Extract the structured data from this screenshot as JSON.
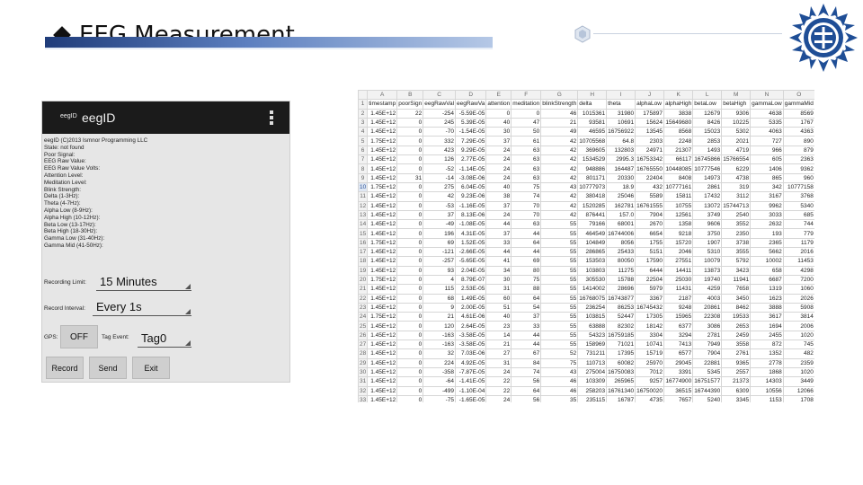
{
  "slide": {
    "title": "EEG Measurement",
    "colors": {
      "title_bar": "#1f3c7a",
      "logo": "#1f4e96"
    }
  },
  "phone": {
    "appbar": {
      "small_label": "eegID",
      "name": "eegID",
      "menu_icon": "overflow-menu-icon"
    },
    "fields": [
      "eegID (C)2013 Ismnor Programming LLC",
      "State: not found",
      "Poor Signal:",
      "EEG Raw Value:",
      "EEG Raw Value Volts:",
      "Attention Level:",
      "Meditation Level:",
      "Blink Strength:",
      "Delta (1-3Hz):",
      "Theta (4-7Hz):",
      "Alpha Low (8-9Hz):",
      "Alpha High (10-12Hz):",
      "Beta Low (13-17Hz):",
      "Beta High (18-30Hz):",
      "Gamma Low (31-40Hz):",
      "Gamma Mid (41-50Hz):"
    ],
    "recording_limit": {
      "label": "Recording Limit:",
      "value": "15 Minutes"
    },
    "record_interval": {
      "label": "Record Interval:",
      "value": "Every 1s"
    },
    "gps": {
      "label": "GPS:",
      "value": "OFF"
    },
    "tag_event": {
      "label": "Tag Event:",
      "value": "Tag0"
    },
    "buttons": {
      "record": "Record",
      "send": "Send",
      "exit": "Exit"
    }
  },
  "sheet": {
    "columns": [
      "",
      "A",
      "B",
      "C",
      "D",
      "E",
      "F",
      "G",
      "H",
      "I",
      "J",
      "K",
      "L",
      "M",
      "N",
      "O"
    ],
    "header_row": [
      "1",
      "timestamp",
      "poorSign",
      "eegRawVal",
      "eegRawVa",
      "attention",
      "meditation",
      "blinkStrength",
      "delta",
      "theta",
      "alphaLow",
      "alphaHigh",
      "betaLow",
      "betaHigh",
      "gammaLow",
      "gammaMid"
    ],
    "rows": [
      [
        "2",
        "1.45E+12",
        "22",
        "-254",
        "-5.59E-05",
        "0",
        "0",
        "46",
        "1015361",
        "31980",
        "175897",
        "3838",
        "12679",
        "9306",
        "4638",
        "8569"
      ],
      [
        "3",
        "1.45E+12",
        "0",
        "245",
        "5.39E-05",
        "40",
        "47",
        "21",
        "93581",
        "10691",
        "15624",
        "15649680",
        "8426",
        "10225",
        "5335",
        "1767"
      ],
      [
        "4",
        "1.45E+12",
        "0",
        "-70",
        "-1.54E-05",
        "30",
        "50",
        "49",
        "46595",
        "16756922",
        "13545",
        "8568",
        "15023",
        "5302",
        "4063",
        "4363"
      ],
      [
        "5",
        "1.75E+12",
        "0",
        "332",
        "7.29E-05",
        "37",
        "61",
        "42",
        "10705568",
        "64.8",
        "2303",
        "2248",
        "2853",
        "2021",
        "727",
        "890"
      ],
      [
        "6",
        "1.45E+12",
        "0",
        "423",
        "9.29E-05",
        "24",
        "63",
        "42",
        "369605",
        "132803",
        "24971",
        "21307",
        "1493",
        "4719",
        "966",
        "879"
      ],
      [
        "7",
        "1.45E+12",
        "0",
        "126",
        "2.77E-05",
        "24",
        "63",
        "42",
        "1534529",
        "2995.3",
        "16753342",
        "66117",
        "16745866",
        "15766554",
        "605",
        "2363"
      ],
      [
        "8",
        "1.45E+12",
        "0",
        "-52",
        "-1.14E-05",
        "24",
        "63",
        "42",
        "948886",
        "164487",
        "16765550",
        "10448085",
        "10777546",
        "6229",
        "1406",
        "9362"
      ],
      [
        "9",
        "1.45E+12",
        "31",
        "-14",
        "-3.08E-06",
        "24",
        "63",
        "42",
        "801171",
        "20330",
        "22404",
        "8408",
        "14973",
        "4738",
        "865",
        "960"
      ],
      [
        "10",
        "1.75E+12",
        "0",
        "275",
        "6.04E-05",
        "40",
        "75",
        "43",
        "10777973",
        "18.9",
        "432",
        "10777161",
        "2861",
        "319",
        "342",
        "10777158"
      ],
      [
        "11",
        "1.45E+12",
        "0",
        "42",
        "9.23E-06",
        "38",
        "74",
        "42",
        "380418",
        "25046",
        "5589",
        "15811",
        "17432",
        "3112",
        "3167",
        "3768"
      ],
      [
        "12",
        "1.45E+12",
        "0",
        "-53",
        "-1.16E-05",
        "37",
        "70",
        "42",
        "1520285",
        "162781",
        "16761555",
        "10755",
        "13072",
        "15744713",
        "9962",
        "5340"
      ],
      [
        "13",
        "1.45E+12",
        "0",
        "37",
        "8.13E-06",
        "24",
        "70",
        "42",
        "876441",
        "157.0",
        "7904",
        "12561",
        "3749",
        "2540",
        "3033",
        "685"
      ],
      [
        "14",
        "1.45E+12",
        "0",
        "-49",
        "-1.08E-05",
        "44",
        "63",
        "55",
        "79166",
        "68001",
        "2670",
        "1358",
        "9606",
        "3552",
        "2632",
        "744"
      ],
      [
        "15",
        "1.45E+12",
        "0",
        "196",
        "4.31E-05",
        "37",
        "44",
        "55",
        "464549",
        "16744006",
        "6654",
        "9218",
        "3750",
        "2350",
        "193",
        "779"
      ],
      [
        "16",
        "1.75E+12",
        "0",
        "69",
        "1.52E-05",
        "33",
        "64",
        "55",
        "104849",
        "8056",
        "1755",
        "15720",
        "1907",
        "3738",
        "2365",
        "1179"
      ],
      [
        "17",
        "1.45E+12",
        "0",
        "-121",
        "-2.66E-05",
        "44",
        "44",
        "55",
        "286865",
        "25433",
        "5151",
        "2046",
        "5310",
        "3555",
        "5662",
        "2016"
      ],
      [
        "18",
        "1.45E+12",
        "0",
        "-257",
        "-5.65E-05",
        "41",
        "69",
        "55",
        "153503",
        "80050",
        "17590",
        "27551",
        "10079",
        "5792",
        "10002",
        "11453"
      ],
      [
        "19",
        "1.45E+12",
        "0",
        "93",
        "2.04E-05",
        "34",
        "80",
        "55",
        "103803",
        "11275",
        "6444",
        "14411",
        "13873",
        "3423",
        "658",
        "4298"
      ],
      [
        "20",
        "1.75E+12",
        "0",
        "4",
        "8.79E-07",
        "30",
        "75",
        "55",
        "305530",
        "15788",
        "22504",
        "25030",
        "19740",
        "11941",
        "6687",
        "7200"
      ],
      [
        "21",
        "1.45E+12",
        "0",
        "115",
        "2.53E-05",
        "31",
        "88",
        "55",
        "1414002",
        "28696",
        "5979",
        "11431",
        "4259",
        "7658",
        "1319",
        "1060"
      ],
      [
        "22",
        "1.45E+12",
        "0",
        "68",
        "1.49E-05",
        "60",
        "64",
        "55",
        "16768075",
        "16743877",
        "3367",
        "2187",
        "4003",
        "3450",
        "1623",
        "2026"
      ],
      [
        "23",
        "1.45E+12",
        "0",
        "9",
        "2.00E-05",
        "51",
        "54",
        "55",
        "236254",
        "86253",
        "16745432",
        "9248",
        "20861",
        "8462",
        "3888",
        "5908"
      ],
      [
        "24",
        "1.75E+12",
        "0",
        "21",
        "4.61E-06",
        "40",
        "37",
        "55",
        "103815",
        "52447",
        "17305",
        "15965",
        "22308",
        "19533",
        "3617",
        "3814"
      ],
      [
        "25",
        "1.45E+12",
        "0",
        "120",
        "2.64E-05",
        "23",
        "33",
        "55",
        "63888",
        "82302",
        "18142",
        "6377",
        "3086",
        "2653",
        "1694",
        "2006"
      ],
      [
        "26",
        "1.45E+12",
        "0",
        "-163",
        "-3.58E-05",
        "14",
        "44",
        "55",
        "54323",
        "16759185",
        "3304",
        "3294",
        "2781",
        "2459",
        "2455",
        "1020"
      ],
      [
        "27",
        "1.45E+12",
        "0",
        "-163",
        "-3.58E-05",
        "21",
        "44",
        "55",
        "158969",
        "71021",
        "10741",
        "7413",
        "7949",
        "3558",
        "872",
        "745"
      ],
      [
        "28",
        "1.45E+12",
        "0",
        "32",
        "7.03E-06",
        "27",
        "67",
        "52",
        "731211",
        "17395",
        "15719",
        "6577",
        "7904",
        "2761",
        "1352",
        "482"
      ],
      [
        "29",
        "1.45E+12",
        "0",
        "224",
        "4.92E-05",
        "31",
        "84",
        "75",
        "110713",
        "60082",
        "25970",
        "29045",
        "22881",
        "9365",
        "2778",
        "2359"
      ],
      [
        "30",
        "1.45E+12",
        "0",
        "-358",
        "-7.87E-05",
        "24",
        "74",
        "43",
        "275004",
        "16750083",
        "7012",
        "3391",
        "5345",
        "2557",
        "1868",
        "1020"
      ],
      [
        "31",
        "1.45E+12",
        "0",
        "-64",
        "-1.41E-05",
        "22",
        "56",
        "46",
        "103309",
        "265965",
        "9257",
        "16774900",
        "16751577",
        "21373",
        "14303",
        "3449"
      ],
      [
        "32",
        "1.45E+12",
        "0",
        "-499",
        "-1.10E-04",
        "22",
        "64",
        "46",
        "258203",
        "16761340",
        "16750020",
        "36515",
        "16744390",
        "6309",
        "10556",
        "12066"
      ],
      [
        "33",
        "1.45E+12",
        "0",
        "-75",
        "-1.65E-05",
        "24",
        "56",
        "35",
        "235115",
        "16787",
        "4735",
        "7657",
        "5240",
        "3345",
        "1153",
        "1708"
      ]
    ]
  }
}
